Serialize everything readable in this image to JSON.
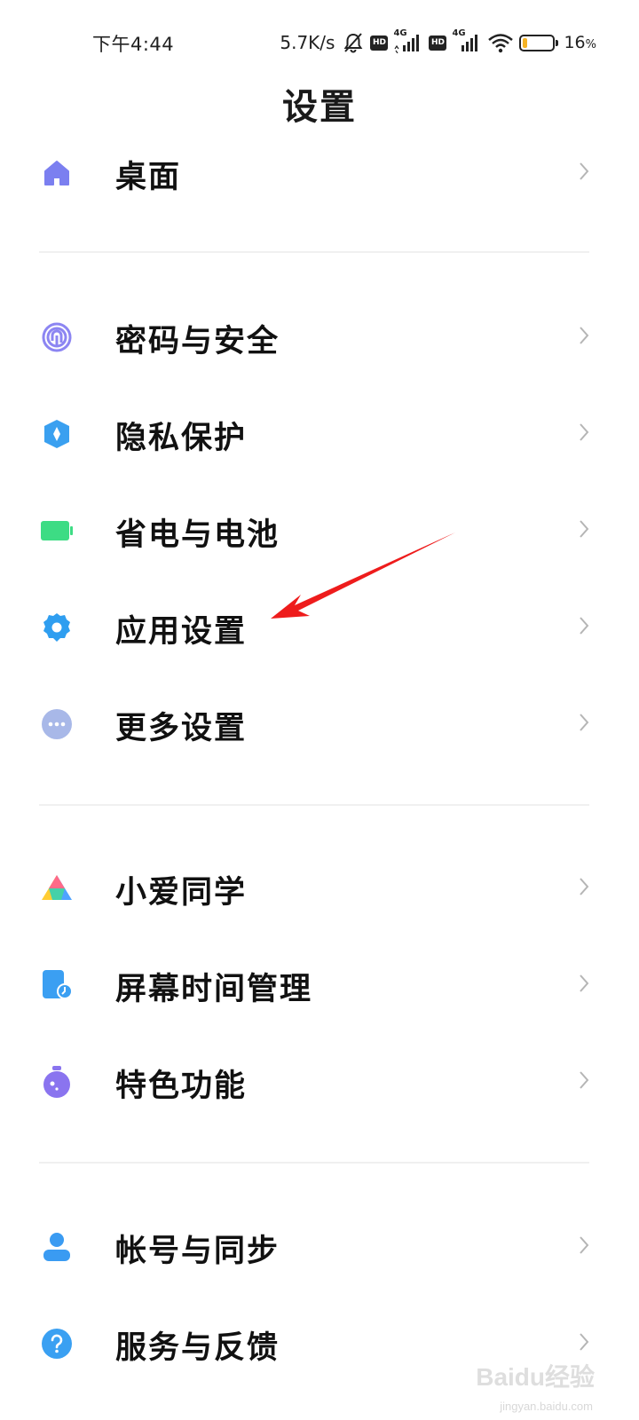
{
  "status_bar": {
    "time": "下午4:44",
    "net_speed": "5.7K/s",
    "hd_label": "HD",
    "signal_label": "4G",
    "battery_percent": "16",
    "battery_unit": "%",
    "battery_level": 0.16,
    "battery_color": "#f5b324"
  },
  "page": {
    "title": "设置"
  },
  "groups": [
    {
      "items": [
        {
          "label": "桌面",
          "icon": "home-icon",
          "color": "#7b7ff0"
        }
      ]
    },
    {
      "items": [
        {
          "label": "密码与安全",
          "icon": "fingerprint-icon",
          "color": "#8c85f2"
        },
        {
          "label": "隐私保护",
          "icon": "privacy-shield-icon",
          "color": "#3aa0f0"
        },
        {
          "label": "省电与电池",
          "icon": "battery-icon",
          "color": "#3ddc84"
        },
        {
          "label": "应用设置",
          "icon": "gear-icon",
          "color": "#2f9ef0"
        },
        {
          "label": "更多设置",
          "icon": "more-dots-icon",
          "color": "#a8b8e8"
        }
      ]
    },
    {
      "items": [
        {
          "label": "小爱同学",
          "icon": "xiaoai-icon",
          "color": "#ff6a88"
        },
        {
          "label": "屏幕时间管理",
          "icon": "screen-time-icon",
          "color": "#3b9ff2"
        },
        {
          "label": "特色功能",
          "icon": "features-icon",
          "color": "#8a74ef"
        }
      ]
    },
    {
      "items": [
        {
          "label": "帐号与同步",
          "icon": "account-icon",
          "color": "#3a9bf2"
        },
        {
          "label": "服务与反馈",
          "icon": "help-icon",
          "color": "#3aa0f2"
        }
      ]
    }
  ],
  "annotation": {
    "arrow_color": "#ee1c1c",
    "points_to": "应用设置"
  },
  "watermark": {
    "text": "Baidu经验",
    "sub": "jingyan.baidu.com"
  }
}
